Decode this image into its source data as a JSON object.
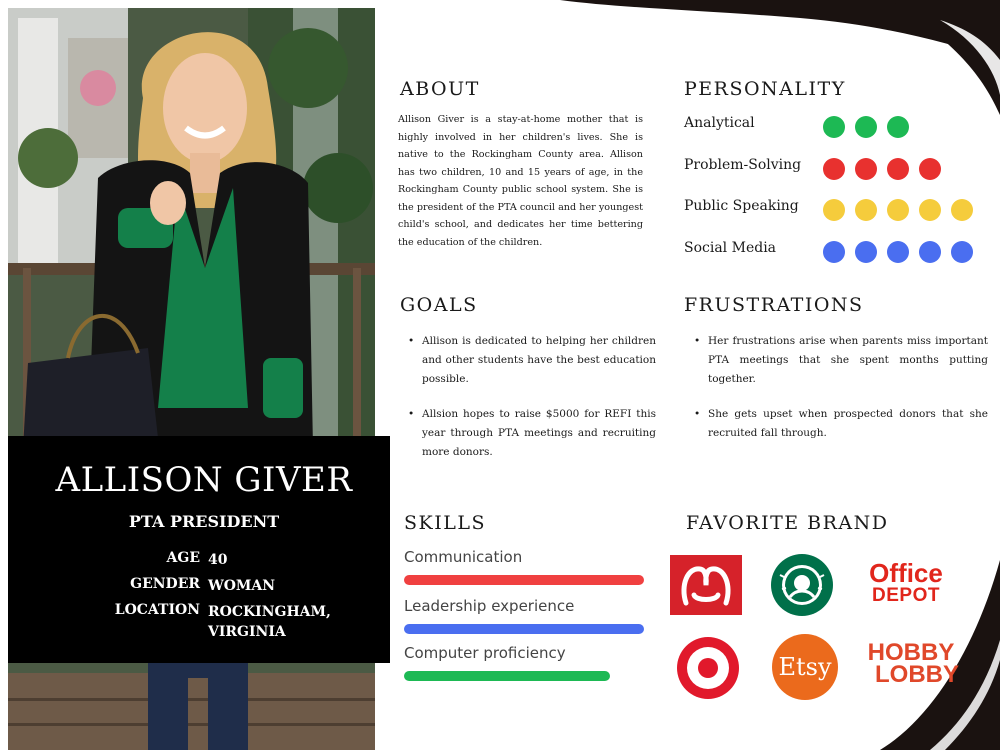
{
  "persona": {
    "name": "ALLISON GIVER",
    "role": "PTA PRESIDENT",
    "facts": [
      {
        "label": "AGE",
        "value": "40"
      },
      {
        "label": "GENDER",
        "value": "WOMAN"
      },
      {
        "label": "LOCATION",
        "value": "ROCKINGHAM, VIRGINIA"
      }
    ]
  },
  "about": {
    "title": "ABOUT",
    "text": "Allison Giver is a stay-at-home mother that is highly involved in her children's lives. She is native to the Rockingham County area. Allison has two children, 10 and 15 years of age, in the Rockingham County public school system. She is the president of the PTA council and her youngest child's school, and dedicates her time bettering the education of the children."
  },
  "goals": {
    "title": "GOALS",
    "items": [
      "Allison is dedicated to helping her children and other students have the best education possible.",
      "Allsion hopes to raise $5000 for REFI this year through PTA meetings and recruiting more donors."
    ]
  },
  "personality": {
    "title": "PERSONALITY",
    "traits": [
      {
        "label": "Analytical",
        "level": 3,
        "color": "#1db954"
      },
      {
        "label": "Problem-Solving",
        "level": 4,
        "color": "#e8312f"
      },
      {
        "label": "Public Speaking",
        "level": 5,
        "color": "#f5cc3c"
      },
      {
        "label": "Social Media",
        "level": 5,
        "color": "#4a6ef0"
      }
    ]
  },
  "frustrations": {
    "title": "FRUSTRATIONS",
    "items": [
      "Her frustrations arise when parents miss important PTA meetings that she spent months putting together.",
      "She gets upset when prospected donors that she recruited fall through."
    ]
  },
  "skills": {
    "title": "SKILLS",
    "items": [
      {
        "label": "Communication",
        "level": 0.98,
        "color": "#f04040"
      },
      {
        "label": "Leadership experience",
        "level": 0.98,
        "color": "#4a6ef0"
      },
      {
        "label": "Computer proficiency",
        "level": 0.84,
        "color": "#1db954"
      }
    ]
  },
  "brands": {
    "title": "FAVORITE BRAND",
    "items": [
      {
        "name": "lululemon",
        "icon": "lululemon-logo"
      },
      {
        "name": "STARBUCKS COFFEE",
        "icon": "starbucks-logo"
      },
      {
        "name": "Office DEPOT",
        "icon": "office-depot-logo",
        "line1": "Office",
        "line2": "DEPOT"
      },
      {
        "name": "Target",
        "icon": "target-logo"
      },
      {
        "name": "Etsy",
        "icon": "etsy-logo",
        "text": "Etsy"
      },
      {
        "name": "HOBBY LOBBY",
        "icon": "hobby-lobby-logo",
        "line1": "HOBBY",
        "line2": "LOBBY"
      }
    ]
  }
}
